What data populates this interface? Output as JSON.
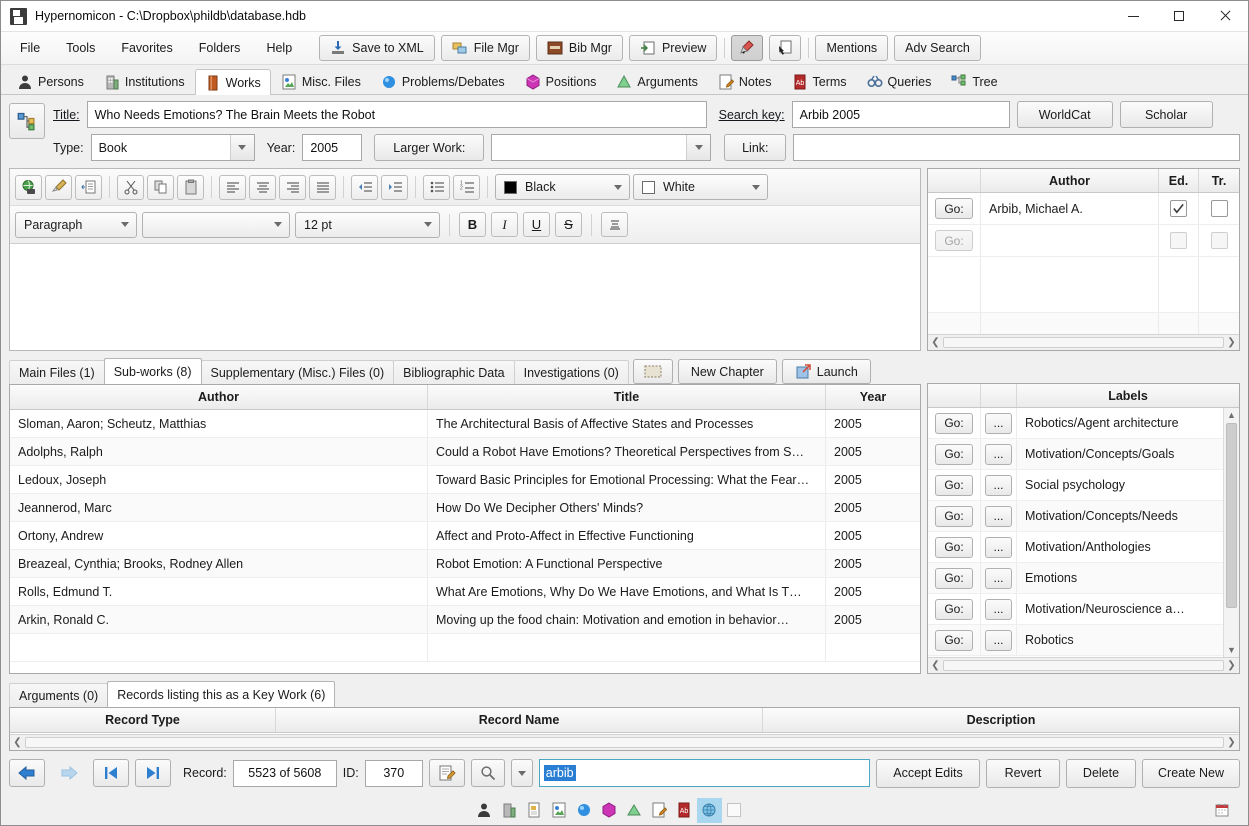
{
  "window": {
    "title": "Hypernomicon - C:\\Dropbox\\phildb\\database.hdb",
    "app_icon": "save-disk-icon",
    "minimize": "minimize-icon",
    "maximize": "maximize-icon",
    "close": "close-icon"
  },
  "menu": {
    "items": [
      "File",
      "Tools",
      "Favorites",
      "Folders",
      "Help"
    ],
    "buttons": [
      {
        "label": "Save to XML",
        "icon": "save-xml-icon"
      },
      {
        "label": "File Mgr",
        "icon": "file-manager-icon"
      },
      {
        "label": "Bib Mgr",
        "icon": "bibliography-icon"
      },
      {
        "label": "Preview",
        "icon": "preview-icon"
      }
    ],
    "icon_buttons": [
      {
        "label": "",
        "icon": "highlighter-pointer-icon",
        "pressed": true
      },
      {
        "label": "",
        "icon": "hand-pointer-icon",
        "pressed": false
      }
    ],
    "right_buttons": [
      "Mentions",
      "Adv Search"
    ]
  },
  "record_tabs": [
    {
      "label": "Persons",
      "icon": "person-icon",
      "active": false
    },
    {
      "label": "Institutions",
      "icon": "building-icon",
      "active": false
    },
    {
      "label": "Works",
      "icon": "book-icon",
      "active": true
    },
    {
      "label": "Misc. Files",
      "icon": "file-image-icon",
      "active": false
    },
    {
      "label": "Problems/Debates",
      "icon": "blue-sphere-icon",
      "active": false
    },
    {
      "label": "Positions",
      "icon": "magenta-cube-icon",
      "active": false
    },
    {
      "label": "Arguments",
      "icon": "green-cone-icon",
      "active": false
    },
    {
      "label": "Notes",
      "icon": "note-pencil-icon",
      "active": false
    },
    {
      "label": "Terms",
      "icon": "red-dictionary-icon",
      "active": false
    },
    {
      "label": "Queries",
      "icon": "binoculars-icon",
      "active": false
    },
    {
      "label": "Tree",
      "icon": "tree-nodes-icon",
      "active": false
    }
  ],
  "header": {
    "tree_button_icon": "tree-nodes-icon",
    "title_label": "Title:",
    "title_value": "Who Needs Emotions? The Brain Meets the Robot",
    "search_key_label": "Search key:",
    "search_key_value": "Arbib 2005",
    "worldcat_button": "WorldCat",
    "scholar_button": "Scholar",
    "type_label": "Type:",
    "type_value": "Book",
    "year_label": "Year:",
    "year_value": "2005",
    "larger_work_button": "Larger Work:",
    "larger_work_value": "",
    "link_button": "Link:",
    "link_value": ""
  },
  "editor": {
    "toolbar_icons": [
      "web-browser-icon",
      "clear-format-brush-icon",
      "paste-plain-icon",
      "cut-icon",
      "copy-icon",
      "paste-icon",
      "align-left-icon",
      "align-center-icon",
      "align-right-icon",
      "align-justify-icon",
      "outdent-icon",
      "indent-icon",
      "bullet-list-icon",
      "numbered-list-icon"
    ],
    "fore_color_label": "Black",
    "fore_color_hex": "#000000",
    "back_color_label": "White",
    "back_color_hex": "#ffffff",
    "paragraph_style": "Paragraph",
    "font_family": "",
    "font_size": "12 pt",
    "format_buttons": [
      "B",
      "I",
      "U",
      "S",
      "clear-style-icon"
    ],
    "body_text": ""
  },
  "authors": {
    "columns": [
      "",
      "Author",
      "Ed.",
      "Tr."
    ],
    "go_label": "Go:",
    "rows": [
      {
        "go": "Go:",
        "author": "Arbib, Michael A.",
        "ed": true,
        "tr": false,
        "enabled": true
      },
      {
        "go": "Go:",
        "author": "",
        "ed": false,
        "tr": false,
        "enabled": false
      }
    ]
  },
  "subworks": {
    "tabs": [
      {
        "label": "Main Files (1)",
        "active": false
      },
      {
        "label": "Sub-works (8)",
        "active": true
      },
      {
        "label": "Supplementary (Misc.) Files (0)",
        "active": false
      },
      {
        "label": "Bibliographic Data",
        "active": false
      },
      {
        "label": "Investigations (0)",
        "active": false
      }
    ],
    "buttons": [
      {
        "label": "",
        "icon": "thumbnail-icon"
      },
      {
        "label": "New Chapter",
        "icon": ""
      },
      {
        "label": "Launch",
        "icon": "launch-icon"
      }
    ],
    "columns": [
      "Author",
      "Title",
      "Year"
    ],
    "rows": [
      {
        "author": "Sloman, Aaron; Scheutz, Matthias",
        "title": "The Architectural Basis of Affective States and Processes",
        "year": "2005"
      },
      {
        "author": "Adolphs, Ralph",
        "title": "Could a Robot Have Emotions? Theoretical Perspectives from S…",
        "year": "2005"
      },
      {
        "author": "Ledoux, Joseph",
        "title": "Toward Basic Principles for Emotional Processing: What the Fear…",
        "year": "2005"
      },
      {
        "author": "Jeannerod, Marc",
        "title": "How Do We Decipher Others' Minds?",
        "year": "2005"
      },
      {
        "author": "Ortony, Andrew",
        "title": "Affect and Proto-Affect in Effective Functioning",
        "year": "2005"
      },
      {
        "author": "Breazeal, Cynthia; Brooks, Rodney Allen",
        "title": "Robot Emotion: A Functional Perspective",
        "year": "2005"
      },
      {
        "author": "Rolls, Edmund T.",
        "title": "What Are Emotions, Why Do We Have Emotions, and What Is T…",
        "year": "2005"
      },
      {
        "author": "Arkin, Ronald C.",
        "title": "Moving up the food chain: Motivation and emotion in behavior…",
        "year": "2005"
      }
    ]
  },
  "labels": {
    "header": "Labels",
    "go_label": "Go:",
    "dots_label": "...",
    "rows": [
      "Robotics/Agent architecture",
      "Motivation/Concepts/Goals",
      "Social psychology",
      "Motivation/Concepts/Needs",
      "Motivation/Anthologies",
      "Emotions",
      "Motivation/Neuroscience a…",
      "Robotics"
    ]
  },
  "bottom": {
    "tabs": [
      {
        "label": "Arguments (0)",
        "active": false
      },
      {
        "label": "Records listing this as a Key Work (6)",
        "active": true
      }
    ],
    "columns": [
      "Record Type",
      "Record Name",
      "Description"
    ]
  },
  "navbar": {
    "back_icon": "arrow-left-icon",
    "forward_icon": "arrow-right-icon",
    "first_icon": "skip-first-icon",
    "last_icon": "skip-last-icon",
    "record_label": "Record:",
    "record_value": "5523 of 5608",
    "id_label": "ID:",
    "id_value": "370",
    "new_search_icon": "new-record-icon",
    "search_icon": "magnifier-icon",
    "search_dropdown_icon": "chevron-down-icon",
    "search_value": "arbib",
    "buttons": [
      "Accept Edits",
      "Revert",
      "Delete",
      "Create New"
    ],
    "filter_icons": [
      {
        "icon": "person-icon",
        "active": false
      },
      {
        "icon": "building-icon",
        "active": false
      },
      {
        "icon": "file-doc-icon",
        "active": false
      },
      {
        "icon": "file-image-icon",
        "active": false
      },
      {
        "icon": "blue-sphere-icon",
        "active": false
      },
      {
        "icon": "magenta-cube-icon",
        "active": false
      },
      {
        "icon": "green-cone-icon",
        "active": false
      },
      {
        "icon": "note-pencil-icon",
        "active": false
      },
      {
        "icon": "red-dictionary-icon",
        "active": false
      },
      {
        "icon": "globe-icon",
        "active": true
      },
      {
        "icon": "blank-icon",
        "active": false
      }
    ],
    "calendar_icon": "calendar-icon"
  }
}
